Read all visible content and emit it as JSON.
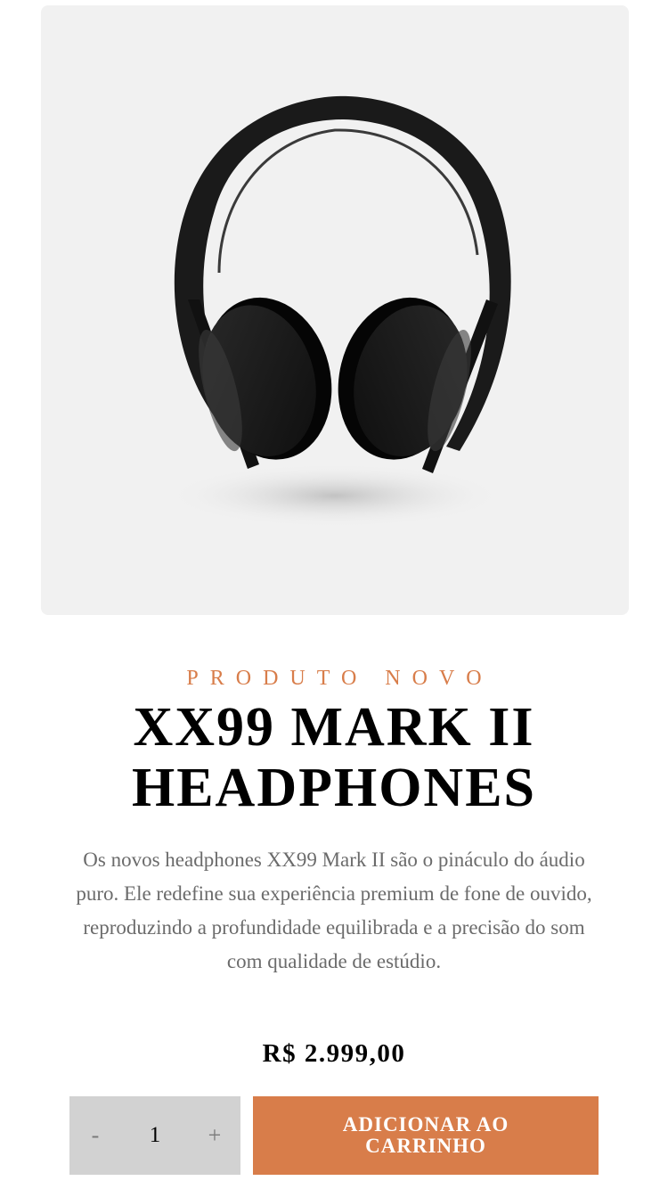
{
  "product": {
    "image_alt": "XX99 Mark II Headphones",
    "overline": "Produto Novo",
    "title_line1": "XX99 Mark II",
    "title_line2": "Headphones",
    "description": "Os novos headphones XX99 Mark II são o pináculo do áudio puro. Ele redefine sua experiência premium de fone de ouvido, reproduzindo a profundidade equilibrada e a precisão do som com qualidade de estúdio.",
    "price": "R$ 2.999,00"
  },
  "cart": {
    "decrement_label": "-",
    "quantity": "1",
    "increment_label": "+",
    "add_label": "Adicionar ao carrinho"
  },
  "colors": {
    "accent": "#d87d4a",
    "image_bg": "#f1f1f1",
    "stepper_bg": "#d2d2d2",
    "text_muted": "#6b6b6b"
  }
}
